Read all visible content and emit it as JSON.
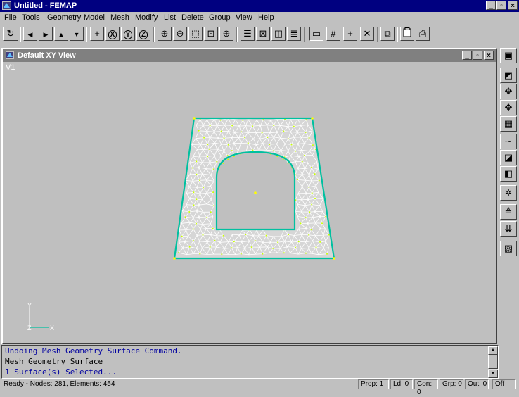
{
  "app": {
    "title": "Untitled - FEMAP",
    "window_buttons": [
      "_",
      "▫",
      "×"
    ]
  },
  "menu": [
    "File",
    "Tools",
    "Geometry",
    "Model",
    "Mesh",
    "Modify",
    "List",
    "Delete",
    "Group",
    "View",
    "Help"
  ],
  "toolbar": [
    {
      "name": "rotate-view-icon",
      "glyph": "↻"
    },
    {
      "name": "pan-left-icon",
      "glyph": "◀"
    },
    {
      "name": "pan-right-icon",
      "glyph": "▶"
    },
    {
      "name": "pan-up-icon",
      "glyph": "▲"
    },
    {
      "name": "pan-down-icon",
      "glyph": "▼"
    },
    {
      "name": "center-icon",
      "glyph": "+"
    },
    {
      "name": "rotate-x-icon",
      "glyph": "X"
    },
    {
      "name": "rotate-y-icon",
      "glyph": "Y"
    },
    {
      "name": "rotate-z-icon",
      "glyph": "Z"
    },
    {
      "name": "zoom-in-icon",
      "glyph": "⊕"
    },
    {
      "name": "zoom-out-icon",
      "glyph": "⊖"
    },
    {
      "name": "zoom-box-icon",
      "glyph": "⬚"
    },
    {
      "name": "autoscale-icon",
      "glyph": "⊡"
    },
    {
      "name": "crosshair-icon",
      "glyph": "⊕"
    },
    {
      "name": "view-options-icon",
      "glyph": "☰"
    },
    {
      "name": "hidden-line-icon",
      "glyph": "⊠"
    },
    {
      "name": "solid-view-icon",
      "glyph": "◫"
    },
    {
      "name": "layers-icon",
      "glyph": "≣"
    },
    {
      "name": "window-icon",
      "glyph": "▭"
    },
    {
      "name": "grid-icon",
      "glyph": "#"
    },
    {
      "name": "workplane-icon",
      "glyph": "+"
    },
    {
      "name": "delete-icon",
      "glyph": "✕"
    },
    {
      "name": "copy-view-icon",
      "glyph": "⧉"
    },
    {
      "name": "clipboard-icon",
      "glyph": "📋"
    },
    {
      "name": "print-icon",
      "glyph": "⎙"
    }
  ],
  "right_toolbar": [
    {
      "name": "save-icon",
      "glyph": "▣"
    },
    {
      "name": "perspective-icon",
      "glyph": "◩"
    },
    {
      "name": "explode-icon",
      "glyph": "✥"
    },
    {
      "name": "node-icon",
      "glyph": "✥"
    },
    {
      "name": "element-icon",
      "glyph": "▦"
    },
    {
      "name": "curve-icon",
      "glyph": "∼"
    },
    {
      "name": "surface-icon",
      "glyph": "◪"
    },
    {
      "name": "solid-icon",
      "glyph": "◧"
    },
    {
      "name": "mesh-icon",
      "glyph": "✲"
    },
    {
      "name": "constraint-icon",
      "glyph": "≙"
    },
    {
      "name": "load-icon",
      "glyph": "⇊"
    },
    {
      "name": "contour-icon",
      "glyph": "▧"
    }
  ],
  "view": {
    "title": "Default XY View",
    "label": "V1",
    "axis_y": "Y",
    "axis_x": "X",
    "axis_z": "Z"
  },
  "messages": [
    "Undoing Mesh Geometry Surface Command.",
    "Mesh Geometry Surface",
    "1 Surface(s) Selected..."
  ],
  "status": {
    "left": "Ready - Nodes: 281, Elements: 454",
    "prop": "Prop: 1",
    "ld": "Ld: 0",
    "con": "Con: 0",
    "grp": "Grp: 0",
    "out": "Out: 0",
    "off": "Off"
  },
  "colors": {
    "title_bg": "#000080",
    "view_bg": "#bfbfbf",
    "mesh_fill": "#d8d8d8",
    "mesh_lines": "#ffffff",
    "boundary": "#00c0a0",
    "nodes": "#c8ff00"
  }
}
